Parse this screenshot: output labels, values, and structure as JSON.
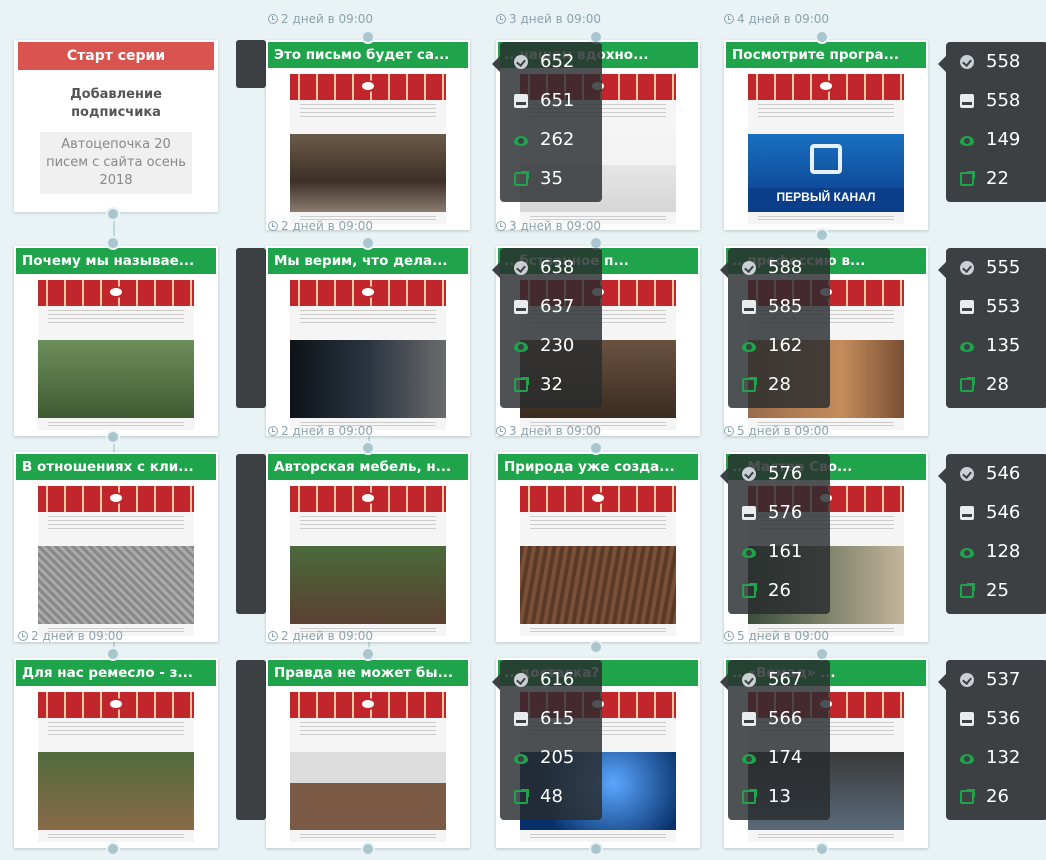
{
  "start": {
    "header": "Старт серии",
    "subtitle": "Добавление подписчика",
    "source": "Автоцепочка 20 писем с сайта осень 2018"
  },
  "colors": {
    "accent_green": "#1fa44c",
    "start_red": "#d9534f",
    "stats_bg": "#3c4043",
    "background": "#e9f3f6"
  },
  "stat_icons": [
    "sent-icon",
    "delivered-icon",
    "opened-icon",
    "clicked-icon"
  ],
  "delays": {
    "r1c2": "2 дней в 09:00",
    "r1c3": "3 дней в 09:00",
    "r1c4": "4 дней в 09:00",
    "r2c2": "2 дней в 09:00",
    "r2c3": "3 дней в 09:00",
    "r3c2": "2 дней в 09:00",
    "r3c3": "3 дней в 09:00",
    "r3c4": "5 дней в 09:00",
    "r4c1": "2 дней в 09:00",
    "r4c2": "2 дней в 09:00",
    "r4c4": "5 дней в 09:00"
  },
  "emails": [
    {
      "title": "Это письмо будет са...",
      "photo": "wooden-chest"
    },
    {
      "title": "...нашем вдохно...",
      "photo": "black-chair"
    },
    {
      "title": "Посмотрите програ...",
      "photo": "first-channel-logo",
      "caption": "ПЕРВЫЙ КАНАЛ"
    },
    {
      "title": "Почему мы называе...",
      "photo": "team-outdoors"
    },
    {
      "title": "Мы верим, что дела...",
      "photo": "artel-man"
    },
    {
      "title": "...бственное п...",
      "photo": "workshop"
    },
    {
      "title": "...профессию в...",
      "photo": "artel-sign"
    },
    {
      "title": "В отношениях с кли...",
      "photo": "stone-texture"
    },
    {
      "title": "Авторская мебель, н...",
      "photo": "garden-table"
    },
    {
      "title": "Природа уже созда...",
      "photo": "wood-grain"
    },
    {
      "title": "...Мастер Сво...",
      "photo": "craftsman"
    },
    {
      "title": "Для нас ремесло - з...",
      "photo": "wooden-gate"
    },
    {
      "title": "Правда не может бы...",
      "photo": "table-vase"
    },
    {
      "title": "...доставка?",
      "photo": "blue-glow"
    },
    {
      "title": "...«Вомад» ...",
      "photo": "tv-screen"
    }
  ],
  "stats": [
    {
      "sent": "652",
      "delivered": "651",
      "opened": "262",
      "clicked": "35"
    },
    {
      "sent": "558",
      "delivered": "558",
      "opened": "149",
      "clicked": "22"
    },
    {
      "sent": "638",
      "delivered": "637",
      "opened": "230",
      "clicked": "32"
    },
    {
      "sent": "588",
      "delivered": "585",
      "opened": "162",
      "clicked": "28"
    },
    {
      "sent": "555",
      "delivered": "553",
      "opened": "135",
      "clicked": "28"
    },
    {
      "sent": "576",
      "delivered": "576",
      "opened": "161",
      "clicked": "26"
    },
    {
      "sent": "546",
      "delivered": "546",
      "opened": "128",
      "clicked": "25"
    },
    {
      "sent": "616",
      "delivered": "615",
      "opened": "205",
      "clicked": "48"
    },
    {
      "sent": "567",
      "delivered": "566",
      "opened": "174",
      "clicked": "13"
    },
    {
      "sent": "537",
      "delivered": "536",
      "opened": "132",
      "clicked": "26"
    }
  ]
}
